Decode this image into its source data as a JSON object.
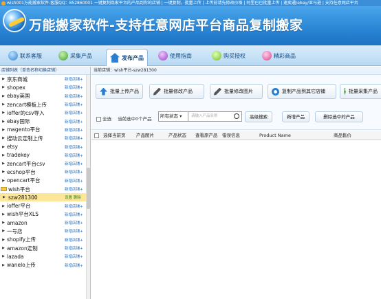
{
  "window": {
    "title": "wish001万能搬家软件-客服QQ：852860001 一键复制商家平台的产品到你的店铺 | 一键复制，批量上传 | 上传前请先修改价格 | 阿里巴巴批量上传 | 速卖通/ebay/亚马逊 | 支持任意网店平台"
  },
  "app": {
    "title": "万能搬家软件-支持任意网店平台商品复制搬家"
  },
  "nav": {
    "items": [
      {
        "label": "联系客服",
        "icon": "globe-icon"
      },
      {
        "label": "采集产品",
        "icon": "collect-icon"
      },
      {
        "label": "发布产品",
        "icon": "home-icon"
      },
      {
        "label": "使用指南",
        "icon": "guide-icon"
      },
      {
        "label": "购买授权",
        "icon": "license-icon"
      },
      {
        "label": "精彩商品",
        "icon": "goods-icon"
      }
    ]
  },
  "sidebar": {
    "header": "店铺列表（单击名称切换店铺）",
    "scroll_position": 0.41,
    "items": [
      {
        "name": "京东商城",
        "action": "新增店铺+"
      },
      {
        "name": "shopex",
        "action": "新增店铺+"
      },
      {
        "name": "ebay英国",
        "action": "新增店铺+"
      },
      {
        "name": "zencart模板上传",
        "action": "新增店铺+"
      },
      {
        "name": "ioffer的csv导入",
        "action": "新增店铺+"
      },
      {
        "name": "ebay国际",
        "action": "新增店铺+"
      },
      {
        "name": "magento平台",
        "action": "新增店铺+"
      },
      {
        "name": "搜动云定制上传",
        "action": "新增店铺+"
      },
      {
        "name": "etsy",
        "action": "新增店铺+"
      },
      {
        "name": "tradekey",
        "action": "新增店铺+"
      },
      {
        "name": "zencart平台csv",
        "action": "新增店铺+"
      },
      {
        "name": "ecshop平台",
        "action": "新增店铺+"
      },
      {
        "name": "opencart平台",
        "action": "新增店铺+"
      },
      {
        "name": "wish平台",
        "action": "新增店铺+"
      },
      {
        "name": "szw281300",
        "action": "设置  删除"
      },
      {
        "name": "ioffer平台",
        "action": "新增店铺+"
      },
      {
        "name": "wish平台XLS",
        "action": "新增店铺+"
      },
      {
        "name": "amazon",
        "action": "新增店铺+"
      },
      {
        "name": "一号店",
        "action": "新增店铺+"
      },
      {
        "name": "shopify上传",
        "action": "新增店铺+"
      },
      {
        "name": "amazon定制",
        "action": "新增店铺+"
      },
      {
        "name": "lazada",
        "action": "新增店铺+"
      },
      {
        "name": "wanelo上传",
        "action": "新增店铺+"
      }
    ]
  },
  "main": {
    "breadcrumb": "当前店铺：wish平台-szw281300",
    "toolbar": {
      "batch_upload": "批量上传产品",
      "batch_edit": "批量修改产品",
      "batch_edit_images": "批量修改图片",
      "copy_to_store": "复制产品到其它店铺",
      "batch_collect": "批量采集产品"
    },
    "filter": {
      "select_all": "全选",
      "count_text": "当前选中0个产品",
      "status_select": "所有状态",
      "search_placeholder": "请输入产品名称",
      "advanced_search": "高级搜索",
      "add_product": "新增产品",
      "delete_selected": "删除选中的产品"
    },
    "table": {
      "columns": [
        "选择当前页",
        "产品图片",
        "产品状态",
        "查看原产品",
        "错误信息",
        "Product Name",
        "商品售价"
      ]
    }
  }
}
